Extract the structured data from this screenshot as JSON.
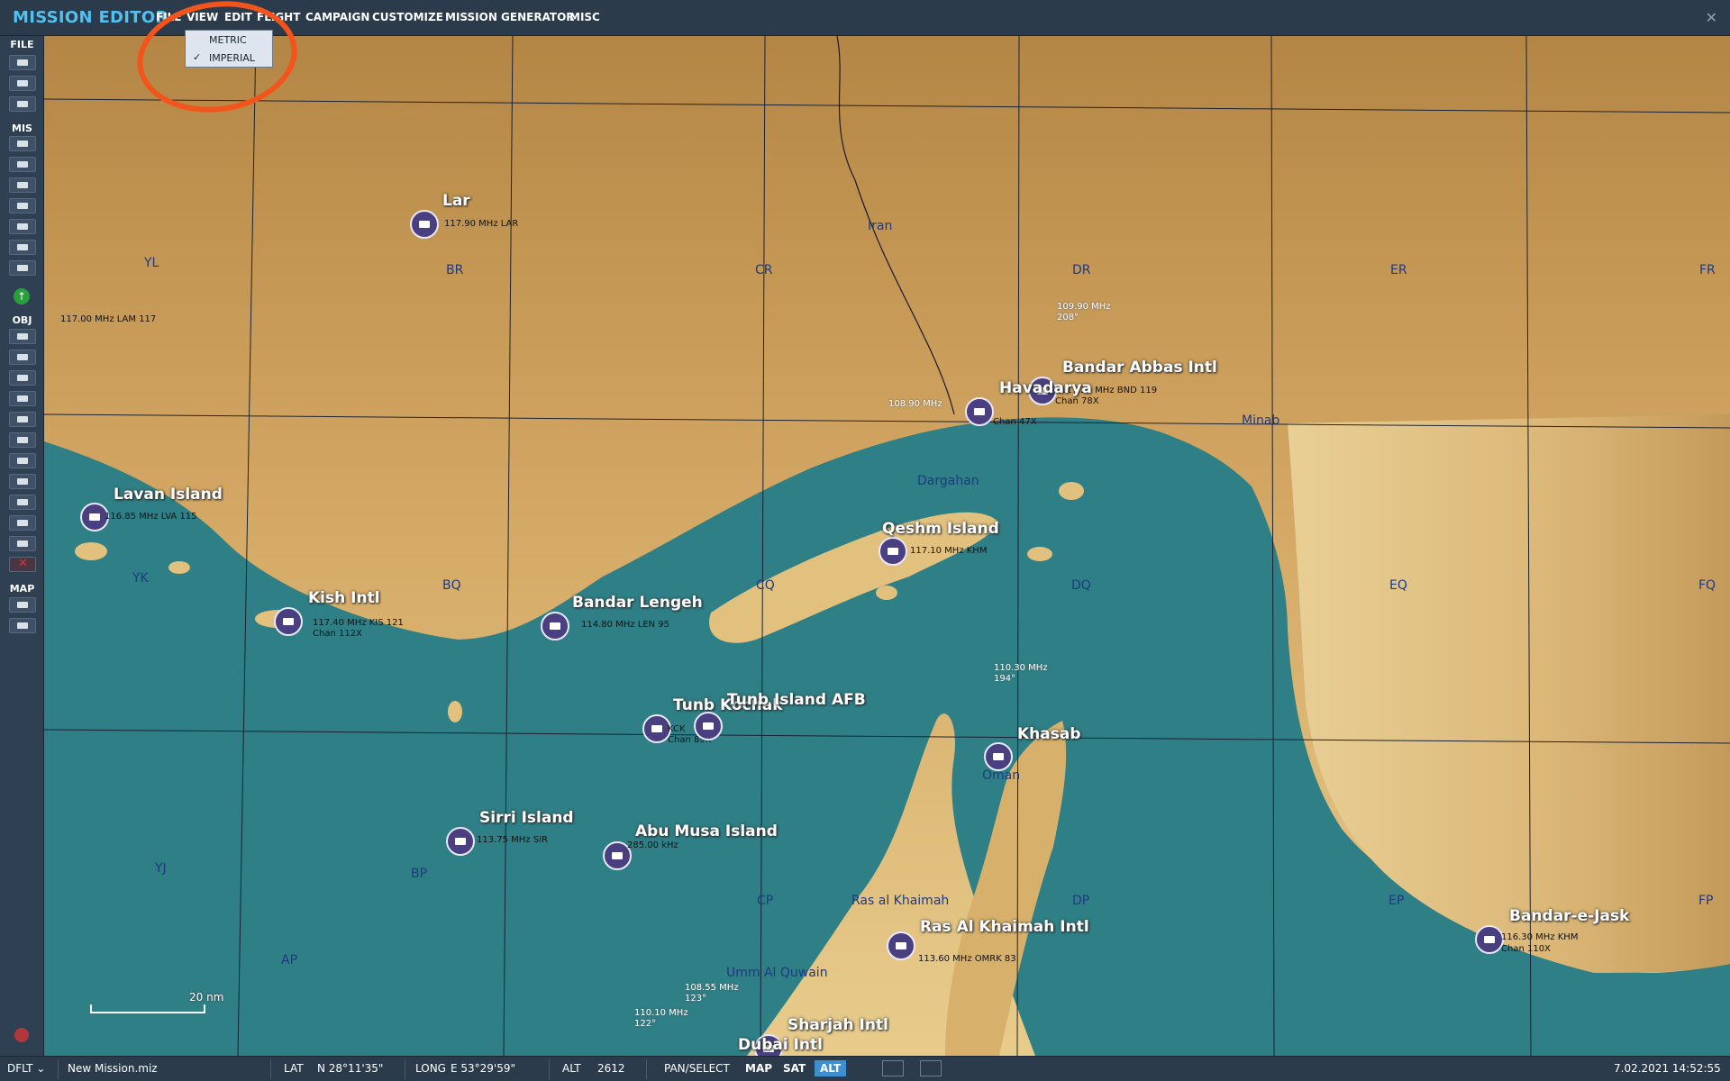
{
  "app": {
    "title": "MISSION EDITOR",
    "close_icon": "close-icon"
  },
  "menu": [
    "FILE",
    "VIEW",
    "EDIT",
    "FLIGHT",
    "CAMPAIGN",
    "CUSTOMIZE",
    "MISSION GENERATOR",
    "MISC"
  ],
  "view_dropdown": {
    "items": [
      {
        "label": "METRIC",
        "checked": false
      },
      {
        "label": "IMPERIAL",
        "checked": true
      }
    ],
    "check_glyph": "✓"
  },
  "annotation": {
    "color": "#f2541b"
  },
  "toolbar": {
    "file": "FILE",
    "mis": "MIS",
    "obj": "OBJ",
    "map": "MAP",
    "icons": {
      "file": [
        "new-file-icon",
        "open-file-icon",
        "save-file-icon"
      ],
      "mis": [
        "briefing-icon",
        "weather-icon",
        "route-icon",
        "trigger-icon",
        "flag-icon",
        "check-icon",
        "templates-icon"
      ],
      "obj": [
        "plane-icon",
        "helicopter-icon",
        "ship-icon",
        "vehicle-icon",
        "static-icon",
        "zone-icon",
        "nav-point-icon",
        "target-icon",
        "close-circle-icon",
        "formation-icon",
        "shapes-icon",
        "delete-icon"
      ],
      "map": [
        "ruler-icon",
        "measure-icon"
      ],
      "round": "add-unit-icon"
    }
  },
  "map": {
    "grid_labels": [
      "YL",
      "BR",
      "CR",
      "DR",
      "ER",
      "FR",
      "YK",
      "BQ",
      "CQ",
      "DQ",
      "EQ",
      "FQ",
      "YJ",
      "BP",
      "CP",
      "DP",
      "EP",
      "FP",
      "AP"
    ],
    "places": [
      "Iran",
      "Minab",
      "Dargahan",
      "Ras al Khaimah",
      "Umm Al Quwain",
      "Oman"
    ],
    "airbases": [
      {
        "name": "Lar",
        "freq": "117.90 MHz LAR"
      },
      {
        "name": "Lavan Island",
        "freq": "116.85 MHz LVA 115"
      },
      {
        "name": "Kish Intl",
        "freq": "117.40 MHz KIS 121",
        "extra": "Chan 112X"
      },
      {
        "name": "Bandar Lengeh",
        "freq": "114.80 MHz LEN 95"
      },
      {
        "name": "Qeshm Island",
        "freq": "117.10 MHz KHM"
      },
      {
        "name": "Bandar Abbas Intl",
        "freq": "117.20 MHz BND 119",
        "extra": "Chan 78X"
      },
      {
        "name": "Havadarya",
        "freq": "108.90 MHz",
        "extra": "Chan 47X"
      },
      {
        "name": "Tunb Kochak",
        "freq": "KCK",
        "extra": "Chan 89X"
      },
      {
        "name": "Tunb Island AFB"
      },
      {
        "name": "Khasab",
        "freq": "110.30 MHz",
        "extra": "194°"
      },
      {
        "name": "Sirri Island",
        "freq": "113.75 MHz SIR"
      },
      {
        "name": "Abu Musa Island",
        "freq": "285.00 kHz"
      },
      {
        "name": "Ras Al Khaimah Intl",
        "freq": "113.60 MHz OMRK 83"
      },
      {
        "name": "Sharjah Intl",
        "freq": "108.55 MHz",
        "extra": "123°"
      },
      {
        "name": "Dubai Intl",
        "freq": "110.10 MHz",
        "extra": "122°"
      },
      {
        "name": "Bandar-e-Jask",
        "freq": "116.30 MHz KHM",
        "extra": "Chan 110X"
      }
    ],
    "misc": [
      {
        "text": "117.00 MHz LAM 117"
      },
      {
        "text": "109.90 MHz",
        "extra": "208°"
      }
    ],
    "scale": "20 nm"
  },
  "status": {
    "profile": "DFLT",
    "filename": "New Mission.miz",
    "lat_label": "LAT",
    "lat": "N 28°11'35\"",
    "long_label": "LONG",
    "long": "E 53°29'59\"",
    "alt_label": "ALT",
    "alt": "2612",
    "mode": "PAN/SELECT",
    "buttons": [
      "MAP",
      "SAT",
      "ALT"
    ],
    "active_button": "ALT",
    "datetime": "7.02.2021 14:52:55"
  },
  "colors": {
    "sea": "#2e7f86",
    "land": "#d8ae6b",
    "accent": "#52c0f0",
    "grid": "#1b2233",
    "active": "#3d8fd0"
  }
}
